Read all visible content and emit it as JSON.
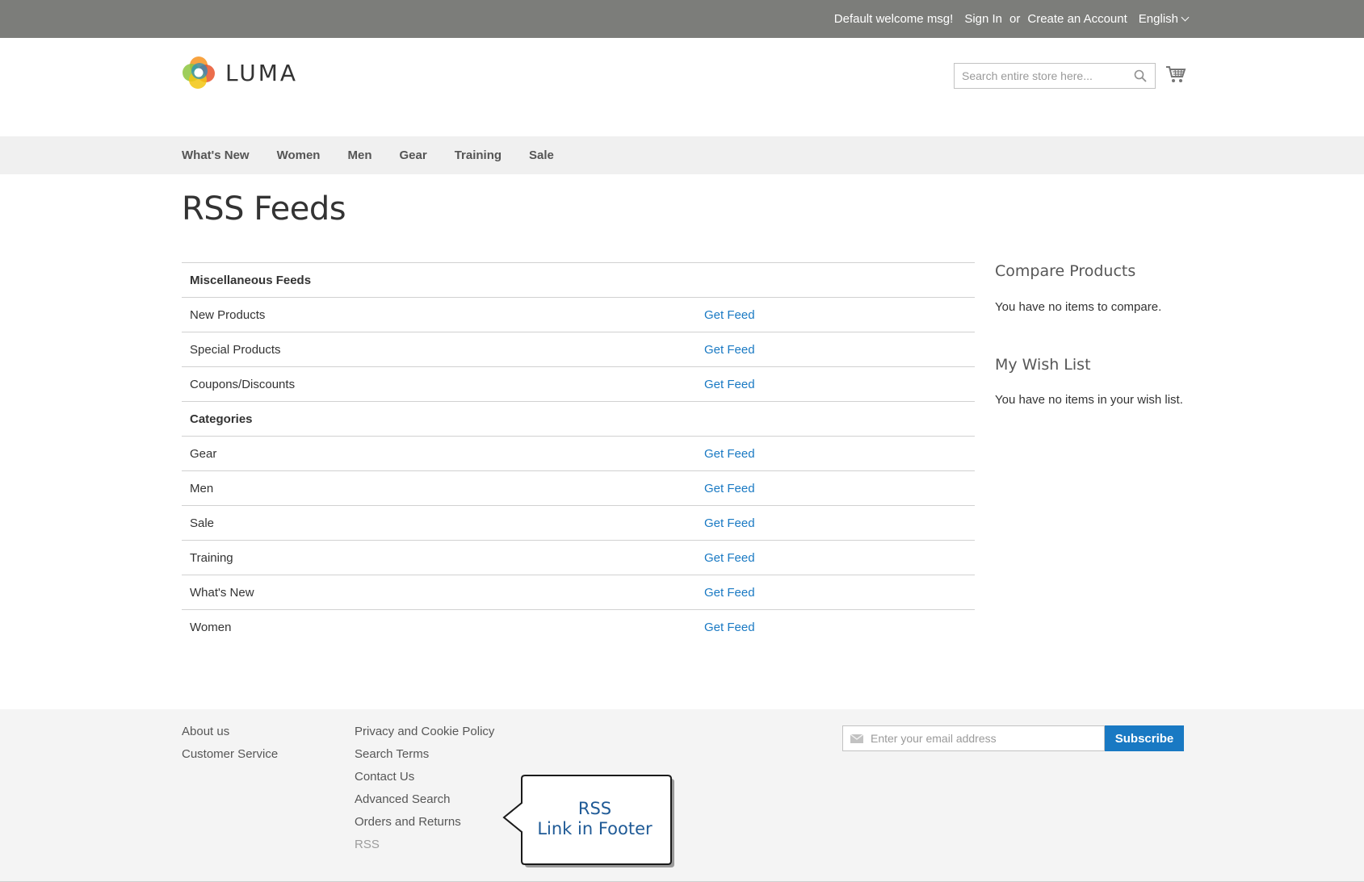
{
  "top_bar": {
    "welcome": "Default welcome msg!",
    "sign_in": "Sign In",
    "or": "or",
    "create_account": "Create an Account",
    "language": "English"
  },
  "header": {
    "logo_text": "LUMA",
    "search_placeholder": "Search entire store here...",
    "search_icon": "search-icon",
    "cart_icon": "cart-icon"
  },
  "nav": {
    "items": [
      "What's New",
      "Women",
      "Men",
      "Gear",
      "Training",
      "Sale"
    ]
  },
  "main": {
    "title": "RSS Feeds",
    "groups": [
      {
        "heading": "Miscellaneous Feeds",
        "rows": [
          {
            "label": "New Products",
            "link": "Get Feed"
          },
          {
            "label": "Special Products",
            "link": "Get Feed"
          },
          {
            "label": "Coupons/Discounts",
            "link": "Get Feed"
          }
        ]
      },
      {
        "heading": "Categories",
        "rows": [
          {
            "label": "Gear",
            "link": "Get Feed"
          },
          {
            "label": "Men",
            "link": "Get Feed"
          },
          {
            "label": "Sale",
            "link": "Get Feed"
          },
          {
            "label": "Training",
            "link": "Get Feed"
          },
          {
            "label": "What's New",
            "link": "Get Feed"
          },
          {
            "label": "Women",
            "link": "Get Feed"
          }
        ]
      }
    ]
  },
  "sidebar": {
    "compare_title": "Compare Products",
    "compare_text": "You have no items to compare.",
    "wishlist_title": "My Wish List",
    "wishlist_text": "You have no items in your wish list."
  },
  "footer": {
    "col1": [
      "About us",
      "Customer Service"
    ],
    "col2": [
      "Privacy and Cookie Policy",
      "Search Terms",
      "Contact Us",
      "Advanced Search",
      "Orders and Returns",
      "RSS"
    ],
    "newsletter_placeholder": "Enter your email address",
    "subscribe_label": "Subscribe"
  },
  "callout": {
    "line1": "RSS",
    "line2": "Link in Footer"
  },
  "colors": {
    "top_bar": "#7c7d7a",
    "link": "#1979c3",
    "nav_bg": "#f0f0f0",
    "footer_bg": "#f4f4f4",
    "callout_text": "#1f5a96"
  }
}
